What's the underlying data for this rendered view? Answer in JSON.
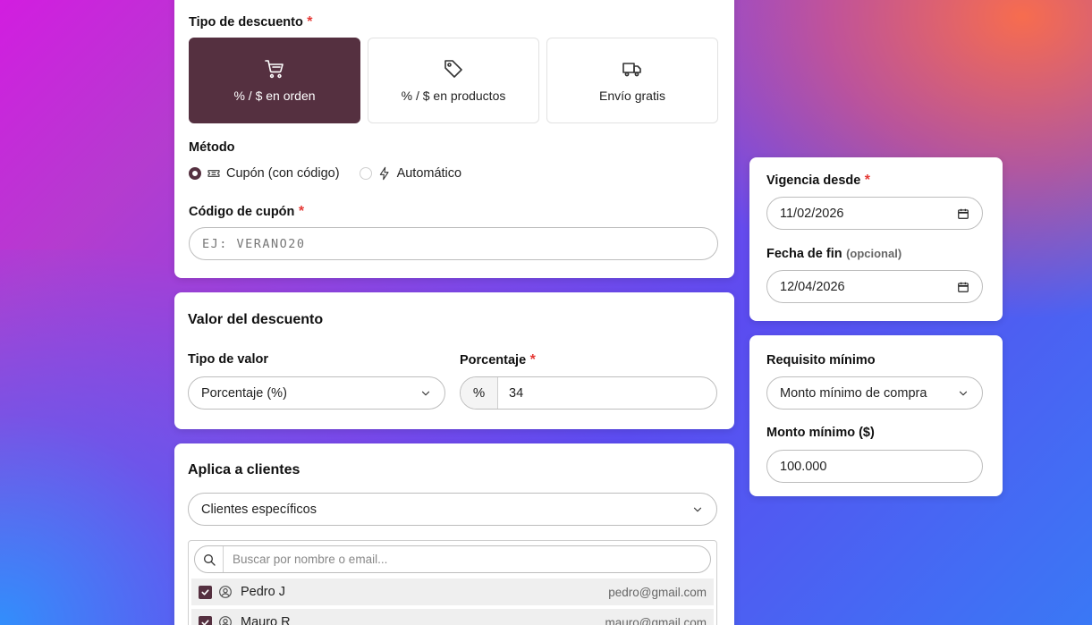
{
  "discount_type": {
    "label": "Tipo de descuento",
    "required_mark": "*",
    "options": [
      {
        "label": "% / $ en orden",
        "icon": "cart-icon",
        "active": true
      },
      {
        "label": "% / $ en productos",
        "icon": "tag-icon",
        "active": false
      },
      {
        "label": "Envío gratis",
        "icon": "truck-icon",
        "active": false
      }
    ]
  },
  "method": {
    "label": "Método",
    "options": [
      {
        "label": "Cupón (con código)",
        "icon": "ticket-icon",
        "selected": true
      },
      {
        "label": "Automático",
        "icon": "bolt-icon",
        "selected": false
      }
    ]
  },
  "coupon": {
    "label": "Código de cupón",
    "required_mark": "*",
    "placeholder": "EJ: VERANO20"
  },
  "value": {
    "title": "Valor del descuento",
    "type_label": "Tipo de valor",
    "type_selected": "Porcentaje (%)",
    "percent_label": "Porcentaje",
    "required_mark": "*",
    "percent_prefix": "%",
    "percent_value": "34"
  },
  "clients": {
    "title": "Aplica a clientes",
    "selected": "Clientes específicos",
    "search_placeholder": "Buscar por nombre o email...",
    "rows": [
      {
        "name": "Pedro J",
        "email": "pedro@gmail.com",
        "checked": true
      },
      {
        "name": "Mauro R",
        "email": "mauro@gmail.com",
        "checked": true
      }
    ]
  },
  "validity": {
    "from_label": "Vigencia desde",
    "required_mark": "*",
    "from_value": "11/02/2026",
    "end_label": "Fecha de fin",
    "end_optional": "(opcional)",
    "end_value": "12/04/2026"
  },
  "requirement": {
    "label": "Requisito mínimo",
    "selected": "Monto mínimo de compra",
    "amount_label": "Monto mínimo ($)",
    "amount_value": "100.000"
  },
  "colors": {
    "accent": "#553040",
    "required": "#e53935"
  }
}
